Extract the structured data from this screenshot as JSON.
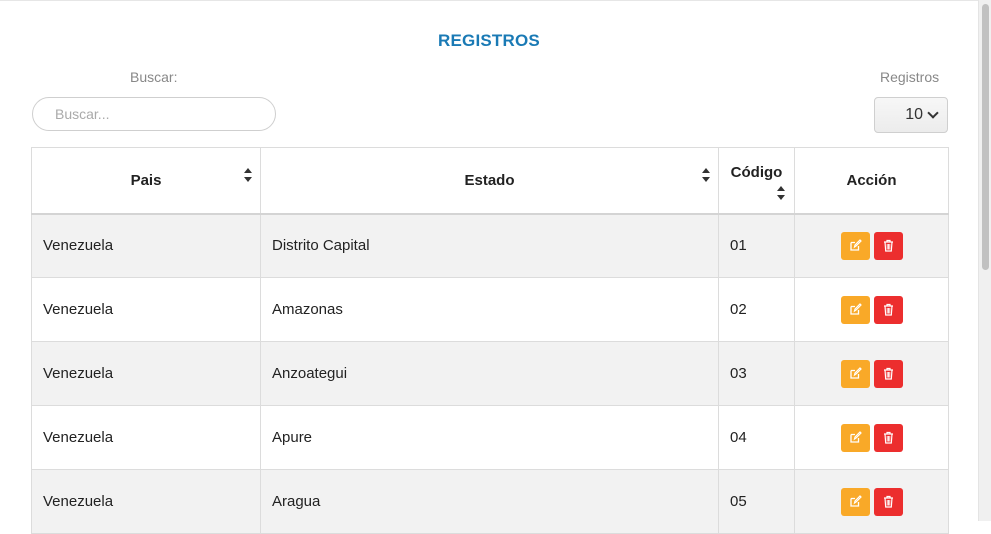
{
  "header": {
    "title": "REGISTROS"
  },
  "search": {
    "label": "Buscar:",
    "placeholder": "Buscar...",
    "value": ""
  },
  "records": {
    "label": "Registros",
    "selected": "10"
  },
  "table": {
    "columns": [
      "Pais",
      "Estado",
      "Código",
      "Acción"
    ],
    "rows": [
      {
        "pais": "Venezuela",
        "estado": "Distrito Capital",
        "codigo": "01"
      },
      {
        "pais": "Venezuela",
        "estado": "Amazonas",
        "codigo": "02"
      },
      {
        "pais": "Venezuela",
        "estado": "Anzoategui",
        "codigo": "03"
      },
      {
        "pais": "Venezuela",
        "estado": "Apure",
        "codigo": "04"
      },
      {
        "pais": "Venezuela",
        "estado": "Aragua",
        "codigo": "05"
      }
    ]
  },
  "icons": {
    "edit": "edit-icon",
    "delete": "trash-icon"
  },
  "colors": {
    "title": "#1a7ab5",
    "edit": "#f9a928",
    "delete": "#ec2e2e",
    "row_odd": "#f2f2f2"
  }
}
